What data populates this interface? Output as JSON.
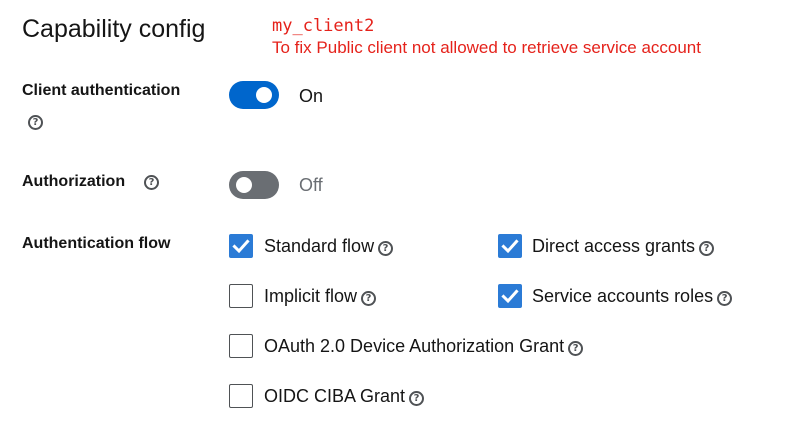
{
  "section_title": "Capability config",
  "annotation": {
    "client_id": "my_client2",
    "note": "To fix Public client not allowed to retrieve service account"
  },
  "client_authentication": {
    "label": "Client authentication",
    "state_label": "On",
    "enabled": true
  },
  "authorization": {
    "label": "Authorization",
    "state_label": "Off",
    "enabled": false
  },
  "authentication_flow": {
    "label": "Authentication flow",
    "options": [
      {
        "label": "Standard flow",
        "checked": true
      },
      {
        "label": "Direct access grants",
        "checked": true
      },
      {
        "label": "Implicit flow",
        "checked": false
      },
      {
        "label": "Service accounts roles",
        "checked": true
      },
      {
        "label": "OAuth 2.0 Device Authorization Grant",
        "checked": false
      },
      {
        "label": "OIDC CIBA Grant",
        "checked": false
      }
    ]
  },
  "colors": {
    "accent": "#0066cc",
    "annotation": "#e5221b",
    "toggle_off": "#6a6e73"
  },
  "icons": {
    "help": "question-circle-icon",
    "check": "checkmark-icon"
  }
}
